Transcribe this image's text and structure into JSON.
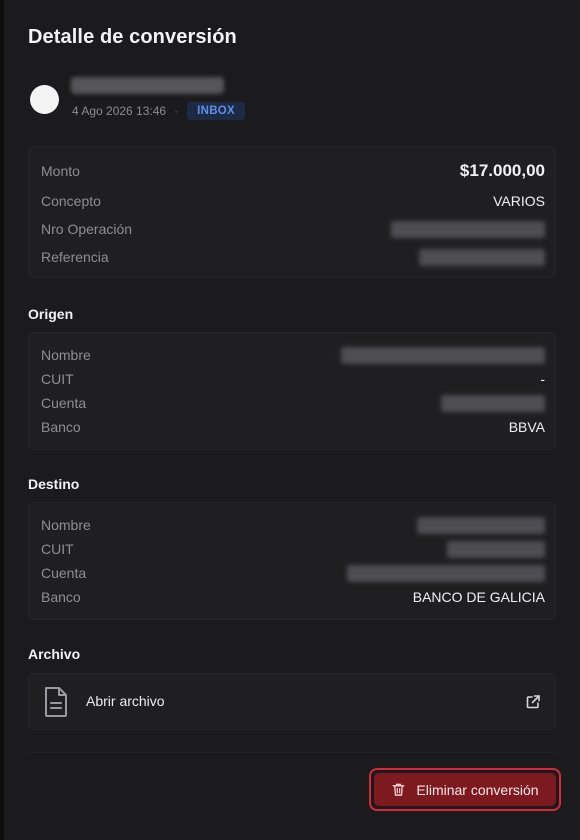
{
  "title": "Detalle de conversión",
  "header": {
    "date": "4 Ago 2026 13:46",
    "separator": "·",
    "badge": "INBOX"
  },
  "summary": {
    "rows": [
      {
        "label": "Monto",
        "value": "$17.000,00"
      },
      {
        "label": "Concepto",
        "value": "VARIOS"
      },
      {
        "label": "Nro Operación",
        "value": ""
      },
      {
        "label": "Referencia",
        "value": ""
      }
    ]
  },
  "origen": {
    "title": "Origen",
    "rows": [
      {
        "label": "Nombre",
        "value": ""
      },
      {
        "label": "CUIT",
        "value": "-"
      },
      {
        "label": "Cuenta",
        "value": ""
      },
      {
        "label": "Banco",
        "value": "BBVA"
      }
    ]
  },
  "destino": {
    "title": "Destino",
    "rows": [
      {
        "label": "Nombre",
        "value": ""
      },
      {
        "label": "CUIT",
        "value": ""
      },
      {
        "label": "Cuenta",
        "value": ""
      },
      {
        "label": "Banco",
        "value": "BANCO DE GALICIA"
      }
    ]
  },
  "archivo": {
    "title": "Archivo",
    "open_label": "Abrir archivo",
    "file_icon": "document-icon",
    "link_icon": "external-link-icon"
  },
  "actions": {
    "delete_label": "Eliminar conversión",
    "delete_icon": "trash-icon"
  },
  "colors": {
    "background": "#1b1b1d",
    "badge": "#5e8fe8",
    "danger": "#7d1a1f",
    "danger_border": "#d8283b"
  }
}
